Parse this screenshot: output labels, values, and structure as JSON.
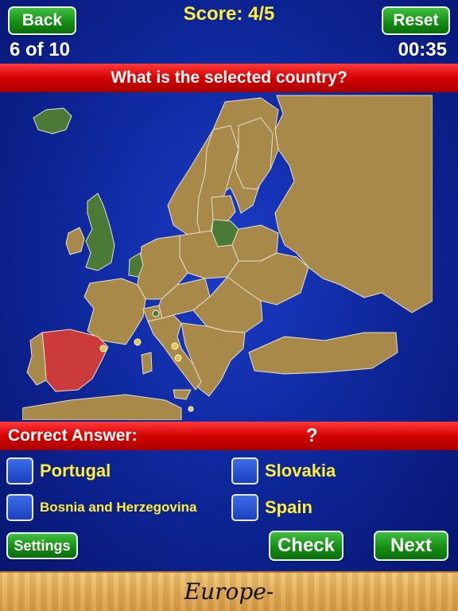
{
  "header": {
    "back_label": "Back",
    "reset_label": "Reset",
    "score": "Score: 4/5",
    "progress": "6 of 10",
    "timer": "00:35"
  },
  "question": "What is the selected country?",
  "answer_bar": {
    "label": "Correct Answer:",
    "value": "?"
  },
  "choices": [
    {
      "label": "Portugal"
    },
    {
      "label": "Slovakia"
    },
    {
      "label": "Bosnia and Herzegovina"
    },
    {
      "label": "Spain"
    }
  ],
  "footer": {
    "settings_label": "Settings",
    "check_label": "Check",
    "next_label": "Next"
  },
  "banner": "Europe-",
  "colors": {
    "land": "#a8894a",
    "selected": "#cc3b3b",
    "answered": "#4a7a35",
    "sea": "#0d2596",
    "score_text": "#ffee33"
  }
}
